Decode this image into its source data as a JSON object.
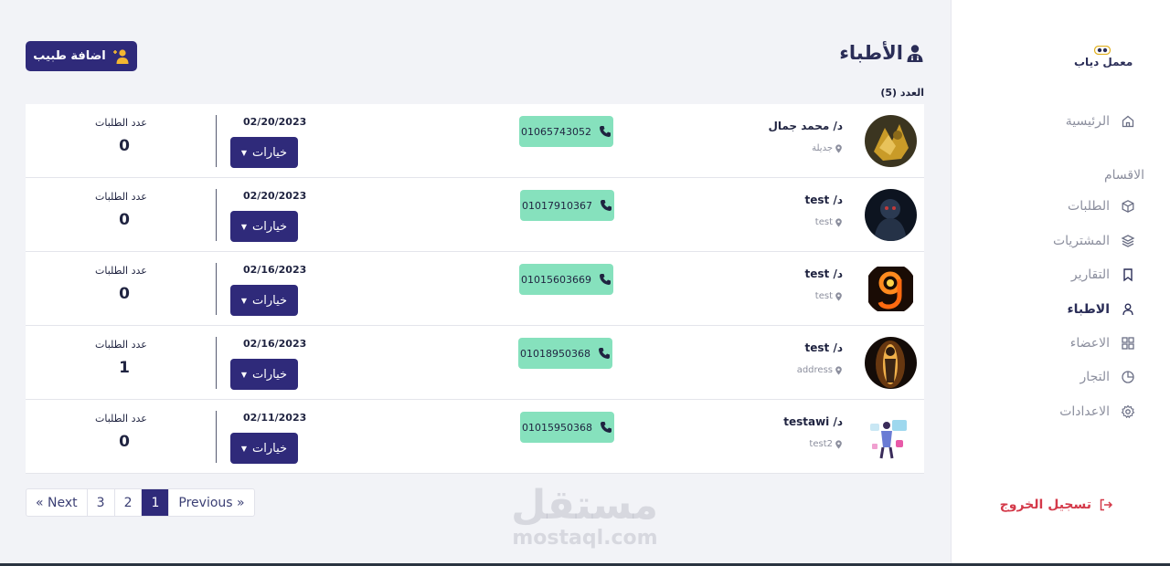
{
  "brand": {
    "name": "معمل دياب"
  },
  "sidebar": {
    "home": {
      "label": "الرئيسية"
    },
    "section_label": "الاقسام",
    "items": [
      {
        "label": "الطلبات",
        "icon": "box-icon"
      },
      {
        "label": "المشتريات",
        "icon": "layers-icon"
      },
      {
        "label": "التقارير",
        "icon": "bookmark-icon"
      },
      {
        "label": "الاطباء",
        "icon": "user-icon",
        "active": true
      },
      {
        "label": "الاعضاء",
        "icon": "grid-icon"
      },
      {
        "label": "التجار",
        "icon": "pie-chart-icon"
      },
      {
        "label": "الاعدادات",
        "icon": "gear-icon"
      }
    ],
    "logout": "تسجيل الخروج"
  },
  "header": {
    "title": "الأطباء",
    "add_button": "اضافة طبيب",
    "count_label": "العدد (5)"
  },
  "doctors": [
    {
      "name": "د/ محمد جمال",
      "address": "جديلة",
      "phone": "01065743052",
      "date": "02/20/2023",
      "options": "خيارات",
      "orders_label": "عدد الطلبات",
      "orders": "0"
    },
    {
      "name": "د/ test",
      "address": "test",
      "phone": "01017910367",
      "date": "02/20/2023",
      "options": "خيارات",
      "orders_label": "عدد الطلبات",
      "orders": "0"
    },
    {
      "name": "د/ test",
      "address": "test",
      "phone": "01015603669",
      "date": "02/16/2023",
      "options": "خيارات",
      "orders_label": "عدد الطلبات",
      "orders": "0"
    },
    {
      "name": "د/ test",
      "address": "address",
      "phone": "01018950368",
      "date": "02/16/2023",
      "options": "خيارات",
      "orders_label": "عدد الطلبات",
      "orders": "1"
    },
    {
      "name": "د/ testawi",
      "address": "test2",
      "phone": "01015950368",
      "date": "02/11/2023",
      "options": "خيارات",
      "orders_label": "عدد الطلبات",
      "orders": "0"
    }
  ],
  "pagination": {
    "next": "« Next",
    "pages": [
      "3",
      "2",
      "1"
    ],
    "active_page": "1",
    "previous": "Previous »"
  },
  "watermark": {
    "arabic": "مستقل",
    "latin": "mostaql.com"
  },
  "colors": {
    "primary": "#2f2a7a",
    "phone_bg": "#86e1bd",
    "logout": "#d43a4a"
  }
}
